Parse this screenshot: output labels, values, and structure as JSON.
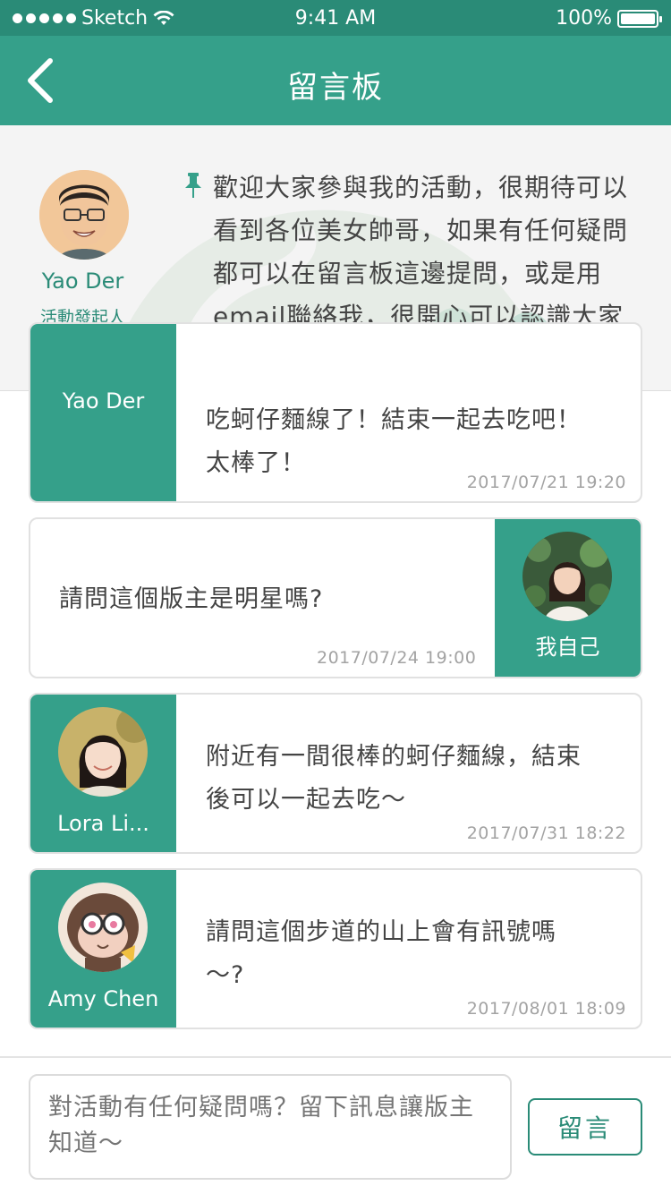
{
  "status": {
    "carrier": "Sketch",
    "time": "9:41 AM",
    "battery": "100%"
  },
  "nav": {
    "title": "留言板",
    "back_icon": "chevron-left-icon"
  },
  "host": {
    "name": "Yao Der",
    "role": "活動發起人",
    "pinned_message": "歡迎大家參與我的活動，很期待可以看到各位美女帥哥，如果有任何疑問都可以在留言板這邊提問，或是用email聯絡我，很開心可以認識大家喔！"
  },
  "messages": [
    {
      "author": "Yao Der",
      "text_lines": [
        "吃蚵仔麵線了！結束一起去吃吧！",
        "太棒了！"
      ],
      "time": "2017/07/21  19:20",
      "side": "left"
    },
    {
      "author": "我自己",
      "text_lines": [
        "請問這個版主是明星嗎?"
      ],
      "time": "2017/07/24 19:00",
      "side": "right"
    },
    {
      "author": "Lora Li...",
      "text_lines": [
        "附近有一間很棒的蚵仔麵線，結束",
        "後可以一起去吃～"
      ],
      "time": "2017/07/31  18:22",
      "side": "left"
    },
    {
      "author": "Amy Chen",
      "text_lines": [
        "請問這個步道的山上會有訊號嗎",
        "～?"
      ],
      "time": "2017/08/01 18:09",
      "side": "left"
    }
  ],
  "compose": {
    "placeholder": "對活動有任何疑問嗎？留下訊息讓版主知道～",
    "send_label": "留言"
  },
  "colors": {
    "nav": "#35a08a",
    "status": "#2a8b77",
    "accent": "#2a8b77"
  }
}
